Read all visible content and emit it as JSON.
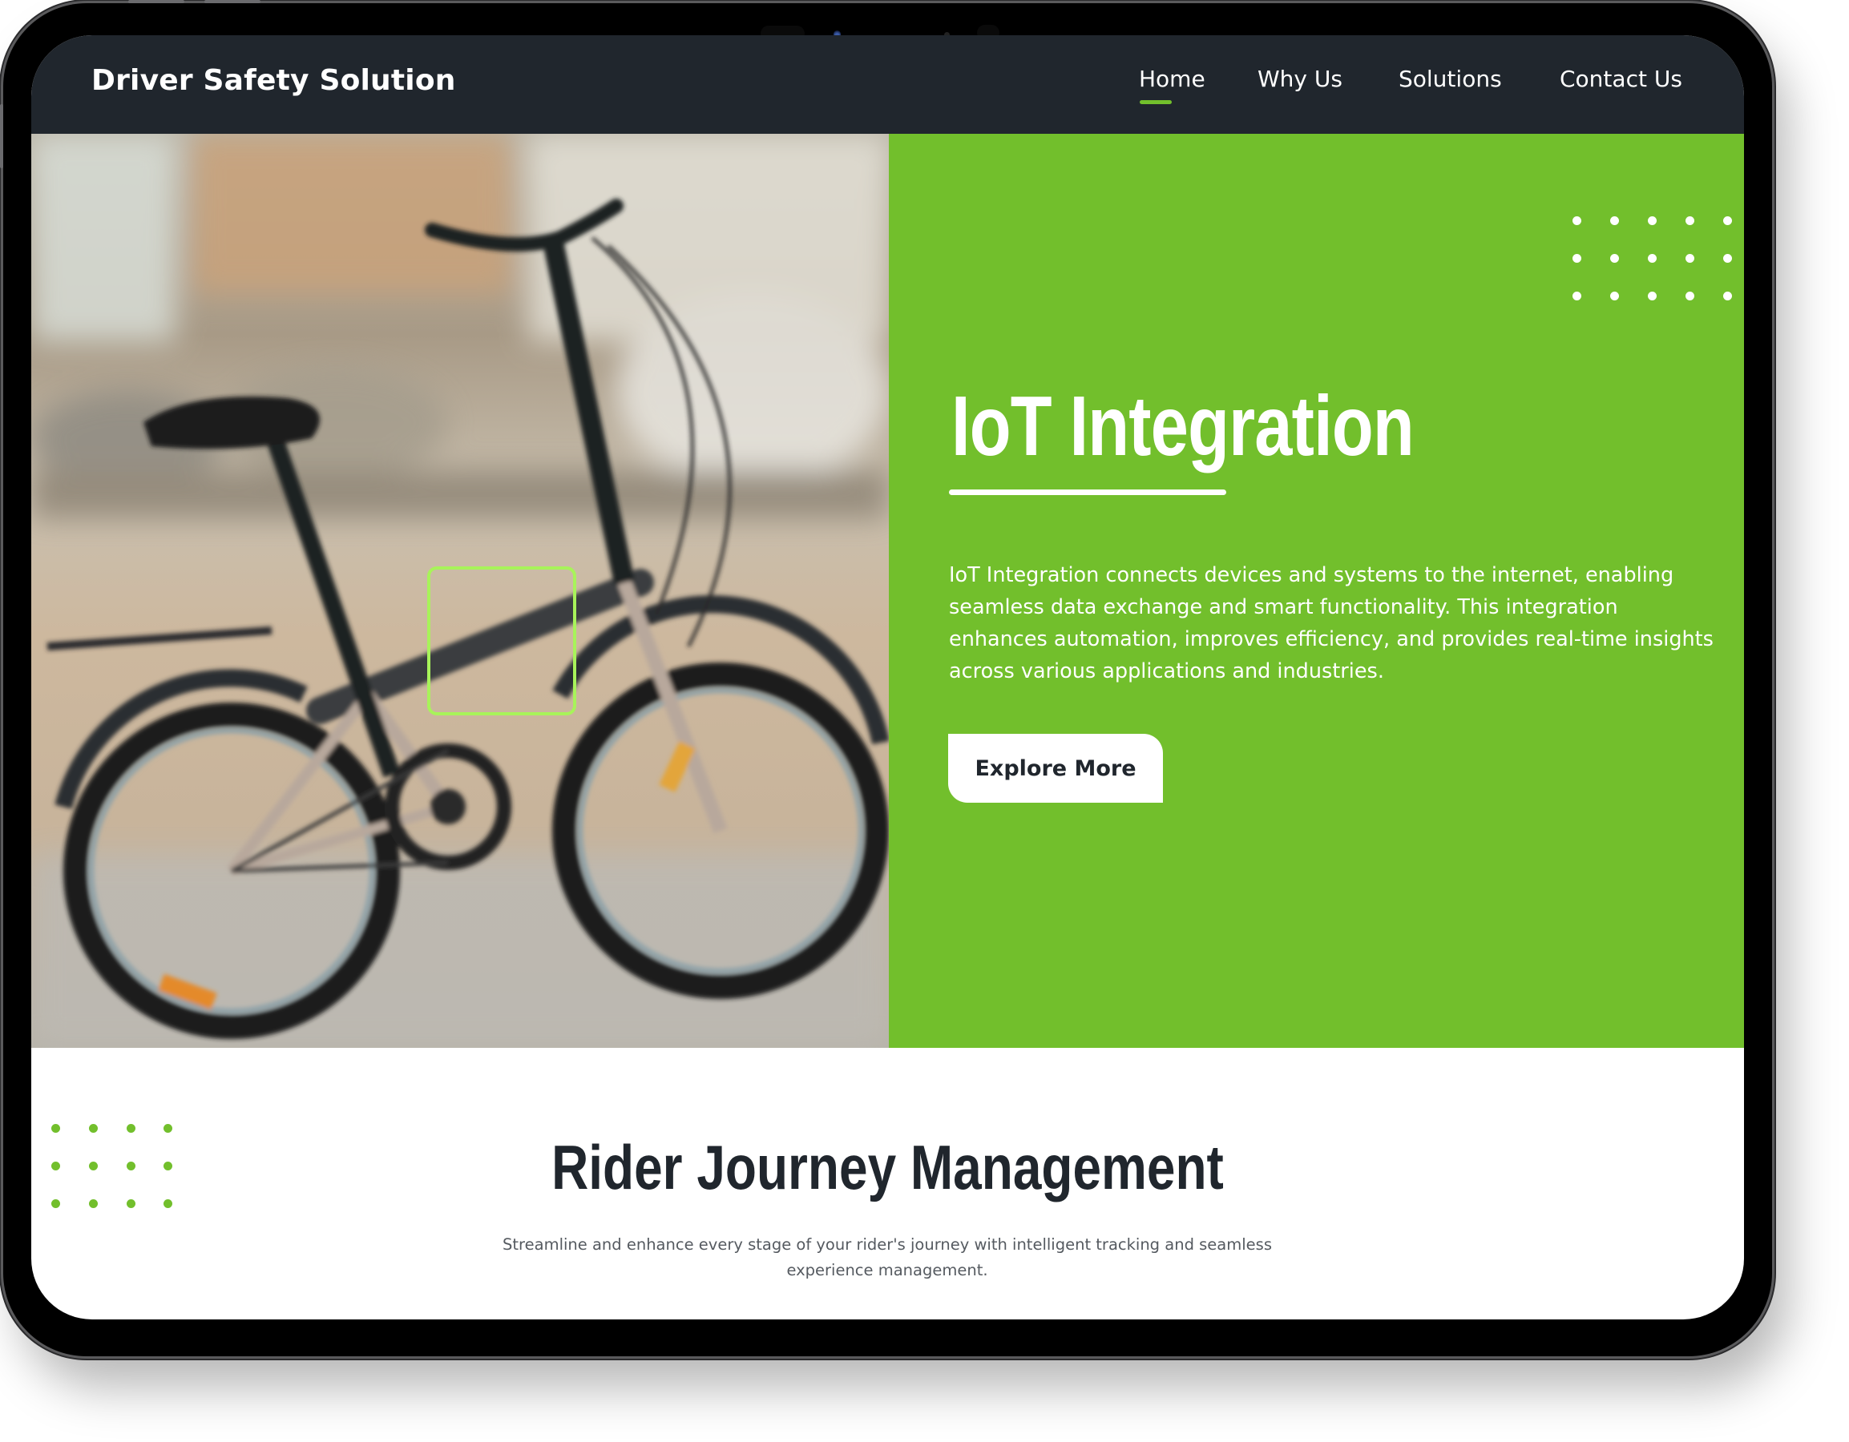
{
  "header": {
    "logo": "Driver Safety Solution",
    "nav": [
      {
        "label": "Home",
        "active": true
      },
      {
        "label": "Why Us",
        "active": false
      },
      {
        "label": "Solutions",
        "active": false
      },
      {
        "label": "Contact Us",
        "active": false
      }
    ]
  },
  "hero": {
    "image_alt": "Folding bicycle parked on a paved plaza",
    "title": "IoT Integration",
    "description": "IoT Integration connects devices and systems to the internet, enabling seamless data exchange and smart functionality. This integration enhances automation, improves efficiency, and provides real-time insights across various applications and industries.",
    "button_label": "Explore More"
  },
  "section": {
    "heading": "Rider Journey Management",
    "subtitle": "Streamline and enhance every stage of your rider's journey with intelligent tracking and seamless experience management."
  },
  "colors": {
    "accent": "#72bf2c",
    "header_bg": "#20262d",
    "highlight": "#a8f35a"
  }
}
